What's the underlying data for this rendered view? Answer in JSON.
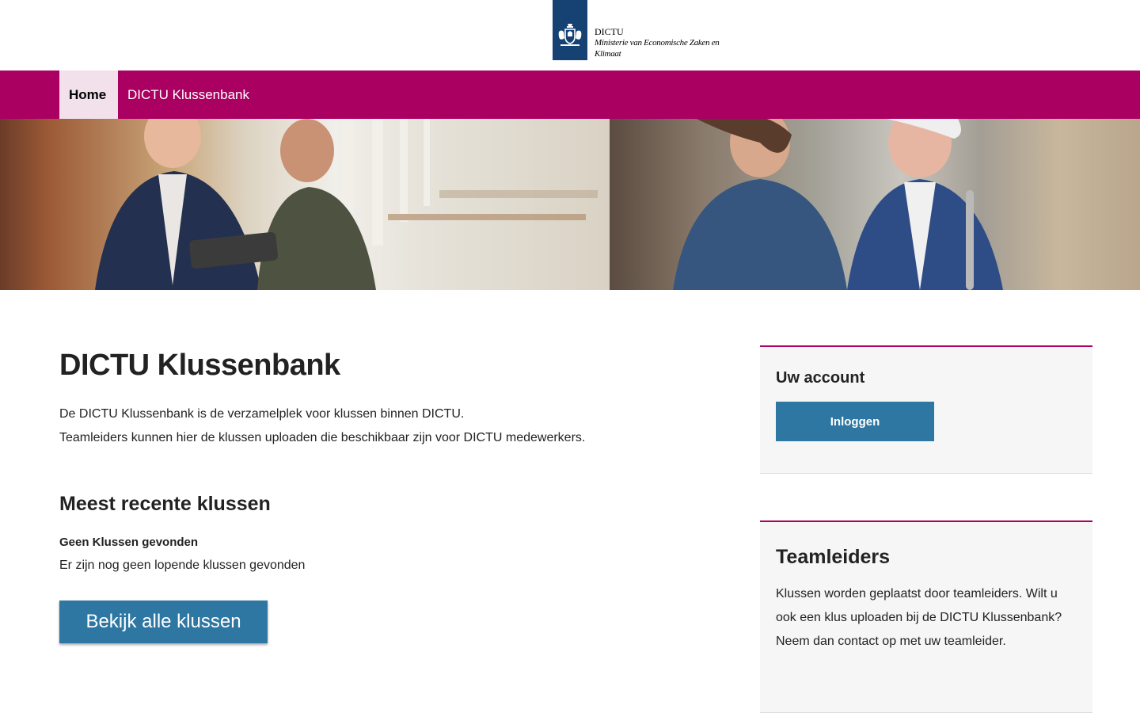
{
  "header": {
    "org_name": "DICTU",
    "ministry": "Ministerie van Economische Zaken en Klimaat",
    "logo_icon": "rijksoverheid-coat-of-arms-icon"
  },
  "colors": {
    "brand": "#a90061",
    "logo_blue": "#154273",
    "button_blue": "#2e77a3",
    "active_tab_bg": "#f2e0ea"
  },
  "nav": {
    "items": [
      {
        "label": "Home",
        "active": true
      },
      {
        "label": "DICTU Klussenbank",
        "active": false
      }
    ]
  },
  "hero": {
    "description": "banner-photo"
  },
  "main": {
    "title": "DICTU Klussenbank",
    "intro_line1": "De DICTU Klussenbank is de verzamelplek voor klussen binnen DICTU.",
    "intro_line2": "Teamleiders kunnen hier de klussen uploaden die beschikbaar zijn voor DICTU medewerkers.",
    "recent_title": "Meest recente klussen",
    "no_results_title": "Geen Klussen gevonden",
    "no_results_text": "Er zijn nog geen lopende klussen gevonden",
    "view_all_label": "Bekijk alle klussen"
  },
  "sidebar": {
    "account": {
      "title": "Uw account",
      "login_label": "Inloggen"
    },
    "teamleaders": {
      "title": "Teamleiders",
      "text": "Klussen worden geplaatst door teamleiders. Wilt u ook een klus uploaden bij de DICTU Klussenbank? Neem dan contact op met uw teamleider."
    }
  }
}
